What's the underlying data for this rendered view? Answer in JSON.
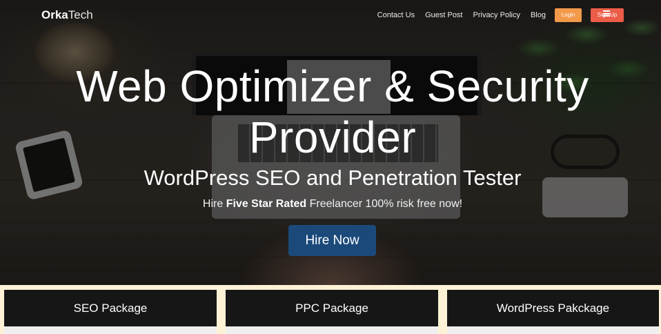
{
  "brand": {
    "name_bold": "Orka",
    "name_light": "Tech"
  },
  "nav": {
    "links": [
      "Contact Us",
      "Guest Post",
      "Privacy Policy",
      "Blog"
    ],
    "login_label": "Login",
    "signup_label": "Sign Up",
    "menu_icon": "hamburger-icon"
  },
  "hero": {
    "title_line1": "Web Optimizer & Security",
    "title_line2": "Provider",
    "subtitle": "WordPress SEO and Penetration Tester",
    "tagline_prefix": "Hire ",
    "tagline_bold": "Five Star Rated",
    "tagline_suffix": " Freelancer 100% risk free now!",
    "cta_label": "Hire Now"
  },
  "packages": [
    {
      "label": "SEO Package"
    },
    {
      "label": "PPC Package"
    },
    {
      "label": "WordPress Pakckage"
    }
  ],
  "colors": {
    "login": "#f2994a",
    "signup": "#ec5c47",
    "cta": "#1b4a7a",
    "package_bg": "#161616",
    "package_band": "#fdf2d6"
  }
}
